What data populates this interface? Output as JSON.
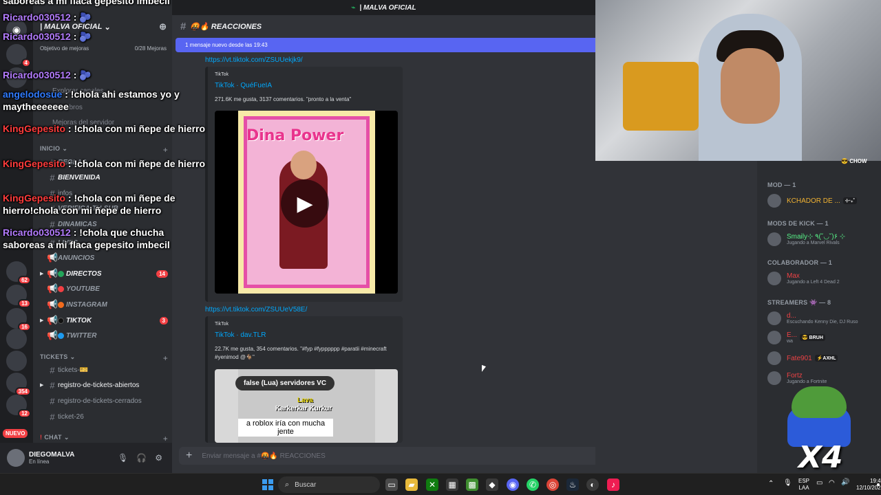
{
  "server": {
    "name": "| MALVA OFICIAL",
    "boost_label": "Objetivo de mejoras",
    "boost_count": "0/28 Mejoras",
    "faded_items": [
      "Explorar canales",
      "Miembros",
      "Mejoras del servidor"
    ]
  },
  "rail": {
    "badges": [
      "4",
      "62",
      "13",
      "16",
      "12",
      "354"
    ],
    "nuevo": "NUEVO"
  },
  "sidebar": {
    "cat_inicio": "INICIO",
    "channels_top": [
      "REGLAS",
      "BIENVENIDA",
      "infos",
      "VERIFICA-TU-SUB",
      "DINAMICAS",
      "LIVES",
      "ANUNCIOS"
    ],
    "directos": "DIRECTOS",
    "directos_badge": "14",
    "youtube": "YOUTUBE",
    "instagram": "INSTAGRAM",
    "tiktok": "TIKTOK",
    "tiktok_badge": "3",
    "twitter": "TWITTER",
    "cat_tickets": "TICKETS",
    "tickets": "tickets-🎫",
    "reg_abiertos": "registro-de-tickets-abiertos",
    "reg_cerrados": "registro-de-tickets-cerrados",
    "ticket26": "ticket-26",
    "cat_chat": "CHAT"
  },
  "user": {
    "name": "DIEGOMALVA",
    "status": "En línea"
  },
  "overlay": [
    {
      "user": "Ricardo030512",
      "text": " : 🫐",
      "style": "u1"
    },
    {
      "user": "Ricardo030512",
      "text": " : 🫐",
      "style": "u1"
    },
    {
      "user": "Ricardo030512",
      "text": " : 🫐",
      "style": "u1"
    },
    {
      "user": "angelodosue",
      "text": " : !chola ahi estamos yo y maytheeeeeee",
      "style": "u3"
    },
    {
      "user": "KingGepesito",
      "text": " : !chola con mi ñepe de hierro",
      "style": "u2"
    },
    {
      "user": "KingGepesito",
      "text": " : !chola con mi ñepe de hierro",
      "style": "u2"
    },
    {
      "user": "KingGepesito",
      "text": " : !chola con mi ñepe de hierro!chola con mi ñepe de hierro",
      "style": "u2"
    },
    {
      "user": "Ricardo030512",
      "text": " : !chola que chucha saboreas a mi flaca gepesito imbecil",
      "style": "u1"
    }
  ],
  "overlay_top": "saboreas a mi flaca gepesito imbecil",
  "main": {
    "topbar": "| MALVA OFICIAL",
    "channel": "🤬🔥 REACCIONES",
    "new_messages": "1 mensaje nuevo desde las 19:43",
    "link1": "https://vt.tiktok.com/ZSUUekjk9/",
    "embed1_provider": "TikTok",
    "embed1_title": "TikTok · QuéFueIA",
    "embed1_desc": "271.6K me gusta, 3137 comentarios. \"pronto a la venta\"",
    "poster_title": "Dina Power",
    "link2": "https://vt.tiktok.com/ZSUUeV58E/",
    "embed2_provider": "TikTok",
    "embed2_title": "TikTok · dav.TLR",
    "embed2_desc": "22.7K me gusta, 354 comentarios. \"#fyp #fypppppp #paratii #minecraft #yenimod @🐐\"",
    "v2_caption1": "false (Lua)",
    "v2_caption2": "servidores VC",
    "v2_lava": "Lava",
    "v2_kurkur": "Karkerkar Kurkur",
    "v2_text": "a roblox iría con mucha jente",
    "composer": "Enviar mensaje a #🤬🔥 REACCIONES"
  },
  "members": {
    "roles": [
      {
        "label": "MOD — 1"
      },
      {
        "label": "MODS DE KICK — 1"
      },
      {
        "label": "COLABORADOR — 1"
      },
      {
        "label": "STREAMERS 👾 — 8"
      }
    ],
    "list": [
      {
        "name": "KCHADOR DE ...",
        "activity": "",
        "tag": "⊹‧₊˚",
        "color": "#f0b232"
      },
      {
        "name": "Smaily⊹ ٩(˘◡˘)۶ ⊹",
        "activity": "Jugando a Marvel Rivals",
        "tag": "",
        "color": "#57f287"
      },
      {
        "name": "Max",
        "activity": "Jugando a Left 4 Dead 2",
        "tag": "",
        "color": "#ed4245"
      },
      {
        "name": "d...",
        "activity": "Escuchando Kenny Die, DJ Ruso",
        "tag": "",
        "color": "#ed4245"
      },
      {
        "name": "E...",
        "activity": "wa",
        "tag": "😎 BRUH",
        "color": "#ed4245"
      },
      {
        "name": "Fate901",
        "activity": "",
        "tag": "⚡AXHL",
        "color": "#ed4245"
      },
      {
        "name": "Fortz",
        "activity": "Jugando a Fortnite",
        "tag": "",
        "color": "#ed4245"
      }
    ],
    "top_tag": "CHOW"
  },
  "overlay_x4": "X4",
  "taskbar": {
    "search": "Buscar",
    "lang1": "ESP",
    "lang2": "LAA",
    "time": "19:47",
    "date": "12/10/2025"
  }
}
